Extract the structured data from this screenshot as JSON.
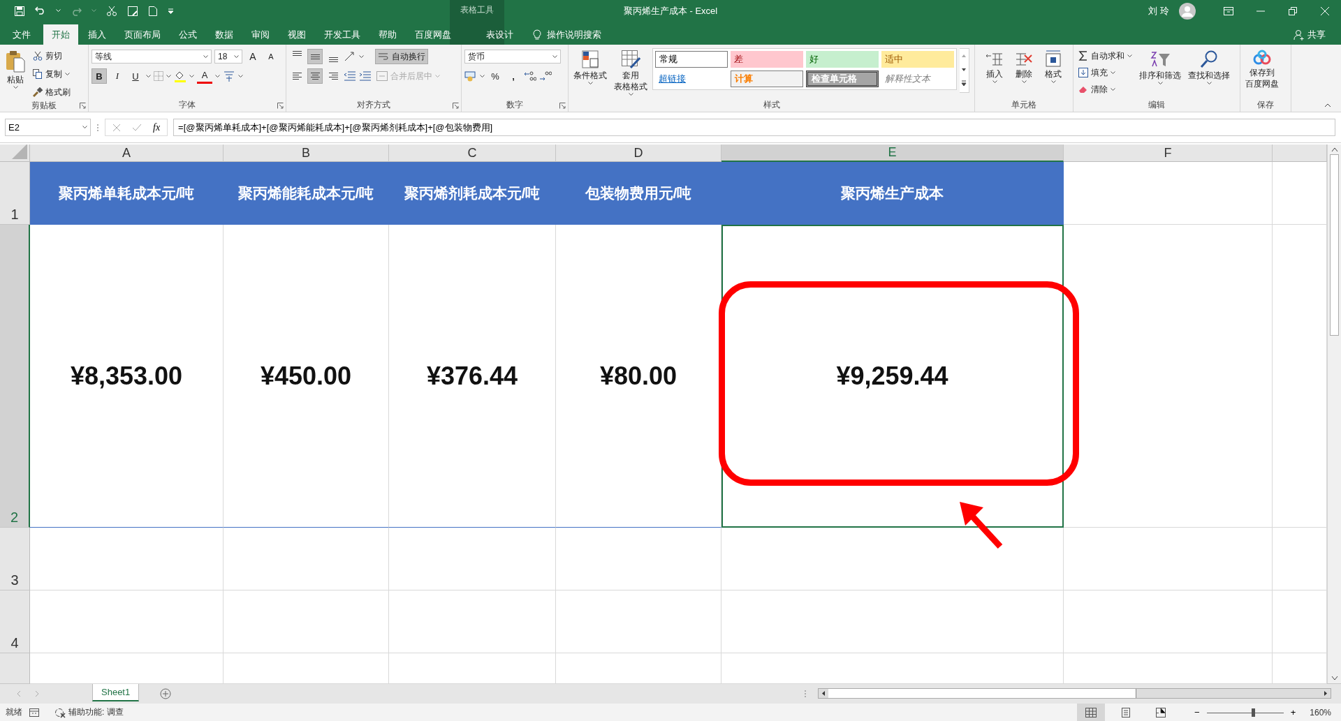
{
  "window": {
    "title": "聚丙烯生产成本  -  Excel",
    "context_group": "表格工具",
    "user": "刘 玲"
  },
  "tabs": [
    {
      "label": "文件",
      "selected": false
    },
    {
      "label": "开始",
      "selected": true
    },
    {
      "label": "插入",
      "selected": false
    },
    {
      "label": "页面布局",
      "selected": false
    },
    {
      "label": "公式",
      "selected": false
    },
    {
      "label": "数据",
      "selected": false
    },
    {
      "label": "审阅",
      "selected": false
    },
    {
      "label": "视图",
      "selected": false
    },
    {
      "label": "开发工具",
      "selected": false
    },
    {
      "label": "帮助",
      "selected": false
    },
    {
      "label": "百度网盘",
      "selected": false
    },
    {
      "label": "表设计",
      "selected": false
    }
  ],
  "tell_me": "操作说明搜索",
  "share": "共享",
  "ribbon": [
    {
      "kind": "clipboard",
      "label": "剪贴板",
      "paste": "粘贴",
      "cut": "剪切",
      "copy": "复制",
      "painter": "格式刷"
    },
    {
      "kind": "font",
      "label": "字体",
      "font_name": "等线",
      "font_size": "18",
      "grow": "A",
      "shrink": "A",
      "font_color": "A",
      "styles": [
        {
          "label": "B",
          "kind": "bold",
          "on": true
        },
        {
          "label": "I",
          "kind": "italic",
          "on": false
        },
        {
          "label": "U",
          "kind": "underline",
          "on": false
        }
      ]
    },
    {
      "kind": "alignment",
      "label": "对齐方式",
      "wrap": "自动换行",
      "wrap_on": true,
      "merge": "合并后居中",
      "merge_disabled": true,
      "aligns": [
        {
          "kind": "top",
          "selected": false
        },
        {
          "kind": "middle",
          "selected": true
        },
        {
          "kind": "bottom",
          "selected": false
        },
        {
          "kind": "left",
          "selected": false
        },
        {
          "kind": "center",
          "selected": true
        },
        {
          "kind": "right",
          "selected": false
        }
      ]
    },
    {
      "kind": "number",
      "label": "数字",
      "format": "货币",
      "percent": "%",
      "comma": ","
    },
    {
      "kind": "styles",
      "label": "样式",
      "conditional": [
        "条件格式"
      ],
      "table_format": [
        "套用",
        "表格格式"
      ],
      "cell_styles": [
        {
          "label": "常规",
          "kind": "normal"
        },
        {
          "label": "差",
          "kind": "bad"
        },
        {
          "label": "好",
          "kind": "good"
        },
        {
          "label": "适中",
          "kind": "neutral"
        },
        {
          "label": "超链接",
          "kind": "link"
        },
        {
          "label": "计算",
          "kind": "calc"
        },
        {
          "label": "检查单元格",
          "kind": "check"
        },
        {
          "label": "解释性文本",
          "kind": "explain"
        }
      ]
    },
    {
      "kind": "cells",
      "label": "单元格",
      "buttons": [
        {
          "label": "插入",
          "kind": "insert"
        },
        {
          "label": "删除",
          "kind": "delete"
        },
        {
          "label": "格式",
          "kind": "format"
        }
      ]
    },
    {
      "kind": "editing",
      "label": "编辑",
      "autosum": "自动求和",
      "fill": "填充",
      "clear": "清除",
      "sort": "排序和筛选",
      "find": "查找和选择"
    },
    {
      "kind": "save",
      "label": "保存",
      "button": [
        "保存到",
        "百度网盘"
      ]
    }
  ],
  "formula_bar": {
    "name_box": "E2",
    "fx": "fx",
    "formula": "=[@聚丙烯单耗成本]+[@聚丙烯能耗成本]+[@聚丙烯剂耗成本]+[@包装物费用]"
  },
  "sheet": {
    "columns": [
      {
        "label": "A",
        "selected": false
      },
      {
        "label": "B",
        "selected": false
      },
      {
        "label": "C",
        "selected": false
      },
      {
        "label": "D",
        "selected": false
      },
      {
        "label": "E",
        "selected": true
      },
      {
        "label": "F",
        "selected": false
      }
    ],
    "rows": [
      {
        "label": "1",
        "selected": false
      },
      {
        "label": "2",
        "selected": true
      },
      {
        "label": "3",
        "selected": false
      },
      {
        "label": "4",
        "selected": false
      }
    ],
    "headers": [
      "聚丙烯单耗成本元/吨",
      "聚丙烯能耗成本元/吨",
      "聚丙烯剂耗成本元/吨",
      "包装物费用元/吨",
      "聚丙烯生产成本"
    ],
    "values": [
      {
        "text": "¥8,353.00",
        "selected": false
      },
      {
        "text": "¥450.00",
        "selected": false
      },
      {
        "text": "¥376.44",
        "selected": false
      },
      {
        "text": "¥80.00",
        "selected": false
      },
      {
        "text": "¥9,259.44",
        "selected": true
      }
    ]
  },
  "sheet_tabs": [
    {
      "label": "Sheet1",
      "selected": true
    }
  ],
  "status_bar": {
    "ready": "就绪",
    "accessibility": "辅助功能: 调查",
    "views": [
      {
        "kind": "normal",
        "selected": true
      },
      {
        "kind": "page_layout",
        "selected": false
      },
      {
        "kind": "page_break",
        "selected": false
      }
    ],
    "zoom": {
      "level": 0.6,
      "minus": "−",
      "plus": "+",
      "text": "160%"
    }
  }
}
